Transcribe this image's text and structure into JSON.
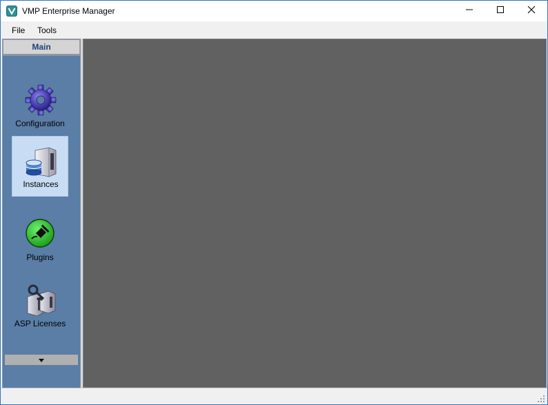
{
  "window": {
    "title": "VMP Enterprise Manager",
    "accent_color": "#2b78c4",
    "app_icon": "vmp-logo-icon"
  },
  "window_controls": {
    "minimize_icon": "minimize-icon",
    "maximize_icon": "maximize-icon",
    "close_icon": "close-icon"
  },
  "menu": {
    "items": [
      {
        "label": "File"
      },
      {
        "label": "Tools"
      }
    ]
  },
  "sidebar": {
    "header": "Main",
    "items": [
      {
        "label": "Configuration",
        "icon": "gear-icon",
        "selected": false
      },
      {
        "label": "Instances",
        "icon": "database-server-icon",
        "selected": true
      },
      {
        "label": "Plugins",
        "icon": "plug-icon",
        "selected": false
      },
      {
        "label": "ASP Licenses",
        "icon": "license-key-icon",
        "selected": false
      }
    ],
    "scroll_icon": "triangle-down-icon"
  },
  "colors": {
    "nav_panel": "#5a7ea6",
    "nav_selected": "#c8ddf3",
    "content_background": "#616161"
  }
}
